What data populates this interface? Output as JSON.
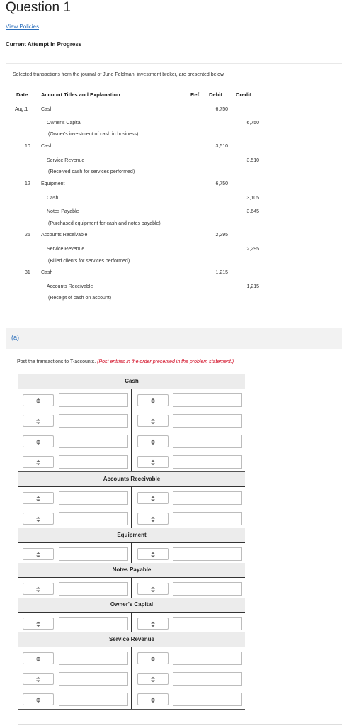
{
  "header": {
    "title": "Question 1",
    "view_policies": "View Policies",
    "attempt_status": "Current Attempt in Progress"
  },
  "problem": {
    "intro": "Selected transactions from the journal of June Feldman, investment broker, are presented below.",
    "columns": {
      "date": "Date",
      "account": "Account Titles and Explanation",
      "ref": "Ref.",
      "debit": "Debit",
      "credit": "Credit"
    },
    "entries": [
      {
        "date": "Aug.1",
        "debit_account": "Cash",
        "debit": "6,750",
        "credit_lines": [
          {
            "account": "Owner's Capital",
            "amount": "6,750"
          }
        ],
        "explanation": "(Owner's investment of cash in business)"
      },
      {
        "date": "10",
        "debit_account": "Cash",
        "debit": "3,510",
        "credit_lines": [
          {
            "account": "Service Revenue",
            "amount": "3,510"
          }
        ],
        "explanation": "(Received cash for services performed)"
      },
      {
        "date": "12",
        "debit_account": "Equipment",
        "debit": "6,750",
        "credit_lines": [
          {
            "account": "Cash",
            "amount": "3,105"
          },
          {
            "account": "Notes Payable",
            "amount": "3,645"
          }
        ],
        "explanation": "(Purchased equipment for cash and notes payable)"
      },
      {
        "date": "25",
        "debit_account": "Accounts Receivable",
        "debit": "2,295",
        "credit_lines": [
          {
            "account": "Service Revenue",
            "amount": "2,295"
          }
        ],
        "explanation": "(Billed clients for services performed)"
      },
      {
        "date": "31",
        "debit_account": "Cash",
        "debit": "1,215",
        "credit_lines": [
          {
            "account": "Accounts Receivable",
            "amount": "1,215"
          }
        ],
        "explanation": "(Receipt of cash on account)"
      }
    ]
  },
  "part_a": {
    "label": "(a)",
    "instruction": "Post the transactions to T-accounts.",
    "instruction_note": "(Post entries in the order presented in the problem statement.)",
    "t_accounts": [
      {
        "title": "Cash",
        "rows": 4
      },
      {
        "title": "Accounts Receivable",
        "rows": 2
      },
      {
        "title": "Equipment",
        "rows": 1
      },
      {
        "title": "Notes Payable",
        "rows": 1
      },
      {
        "title": "Owner's Capital",
        "rows": 1
      },
      {
        "title": "Service Revenue",
        "rows": 3
      }
    ]
  },
  "icons": {
    "select_arrow": "up-down-chevron-icon"
  }
}
